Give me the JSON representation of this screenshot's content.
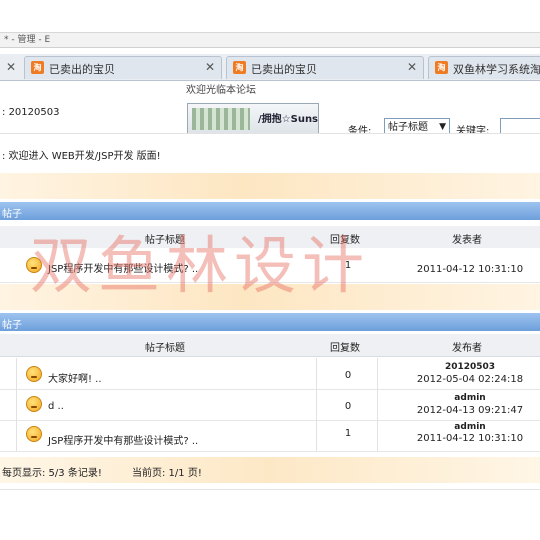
{
  "chrome": {
    "top_fragment": "* - 管理 - E",
    "tabs": [
      {
        "label": ""
      },
      {
        "label": "已卖出的宝贝"
      },
      {
        "label": "已卖出的宝贝"
      },
      {
        "label": "双鱼林学习系统淘宝"
      }
    ],
    "favicon_text": "淘"
  },
  "page": {
    "welcome_title": "欢迎光临本论坛",
    "username_prefix": ":",
    "username": "20120503",
    "thumb_caption": "/拥抱☆Suns",
    "search": {
      "condition_label": "条件:",
      "condition_value": "帖子标题",
      "keyword_label": "关键字:"
    },
    "notice": ": 欢迎进入 WEB开发/JSP开发 版面!"
  },
  "section1": {
    "title": "帖子",
    "columns": {
      "title": "帖子标题",
      "replies": "回复数",
      "author": "发表者"
    },
    "rows": [
      {
        "title": "JSP程序开发中有那些设计模式? ..",
        "replies": "1",
        "date": "2011-04-12 10:31:10"
      }
    ]
  },
  "section2": {
    "title": "帖子",
    "columns": {
      "title": "帖子标题",
      "replies": "回复数",
      "author": "发布者"
    },
    "rows": [
      {
        "title": "大家好啊! ..",
        "replies": "0",
        "author": "20120503",
        "date": "2012-05-04 02:24:18"
      },
      {
        "title": "d ..",
        "replies": "0",
        "author": "admin",
        "date": "2012-04-13 09:21:47"
      },
      {
        "title": "JSP程序开发中有那些设计模式? ..",
        "replies": "1",
        "author": "admin",
        "date": "2011-04-12 10:31:10"
      }
    ]
  },
  "footer": {
    "page_size": "每页显示: 5/3 条记录!",
    "current_page": "当前页: 1/1 页!"
  },
  "watermark": "双鱼林设计"
}
